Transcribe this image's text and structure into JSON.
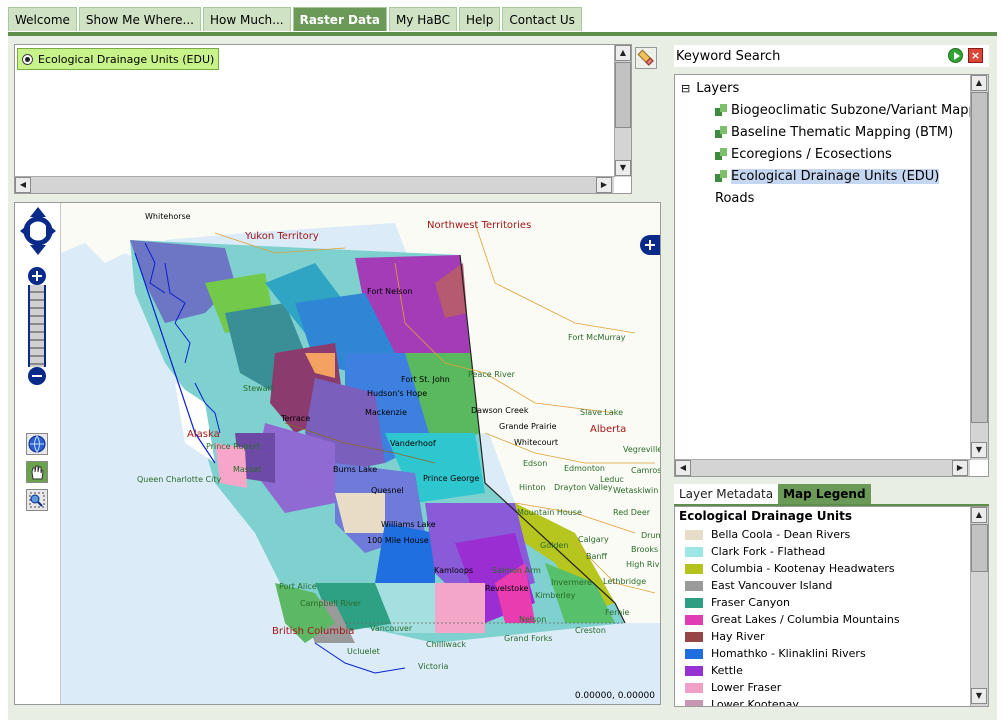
{
  "nav": {
    "tabs": [
      {
        "label": "Welcome",
        "active": false
      },
      {
        "label": "Show Me Where...",
        "active": false
      },
      {
        "label": "How Much...",
        "active": false
      },
      {
        "label": "Raster Data",
        "active": true
      },
      {
        "label": "My HaBC",
        "active": false
      },
      {
        "label": "Help",
        "active": false
      },
      {
        "label": "Contact Us",
        "active": false
      }
    ]
  },
  "selected_layers": {
    "item_label": "Ecological Drainage Units (EDU)",
    "eraser_icon": "eraser-icon"
  },
  "map": {
    "coordinate_readout": "0.00000, 0.00000",
    "labels": {
      "whitehorse": "Whitehorse",
      "yukon": "Yukon Territory",
      "nwt": "Northwest Territories",
      "fort_nelson": "Fort Nelson",
      "fort_mcmurray": "Fort McMurray",
      "peace_river": "Peace River",
      "stewart": "Stewart",
      "alaska": "Alaska",
      "hudsons_hope": "Hudson's Hope",
      "fort_st_john": "Fort St. John",
      "dawson_creek": "Dawson Creek",
      "slave_lake": "Slave Lake",
      "grande_prairie": "Grande Prairie",
      "whitecourt": "Whitecourt",
      "alberta": "Alberta",
      "prince_rupert": "Prince Rupert",
      "terrace": "Terrace",
      "mackenzie": "Mackenzie",
      "vanderhoof": "Vanderhoof",
      "edson": "Edson",
      "edmonton": "Edmonton",
      "vegreville": "Vegreville",
      "camrose": "Camrose",
      "queen_charlotte": "Queen Charlotte City",
      "masset": "Masset",
      "burns_lake": "Burns Lake",
      "prince_george": "Prince George",
      "hinton": "Hinton",
      "drayton_valley": "Drayton Valley",
      "leduc": "Leduc",
      "wetaskiwin": "Wetaskiwin",
      "quesnel": "Quesnel",
      "mountain_house": "Mountain House",
      "red_deer": "Red Deer",
      "williams_lake": "Williams Lake",
      "hundred_mile": "100 Mile House",
      "calgary": "Calgary",
      "drumheller": "Drumheller",
      "brooks": "Brooks",
      "high_river": "High River",
      "golden": "Golden",
      "banff": "Banff",
      "kamloops": "Kamloops",
      "salmon_arm": "Salmon Arm",
      "invermere": "Invermere",
      "lethbridge": "Lethbridge",
      "kimberley": "Kimberley",
      "port_alice": "Port Alice",
      "campbell_river": "Campbell River",
      "british_columbia": "British Columbia",
      "vancouver": "Vancouver",
      "chilliwack": "Chilliwack",
      "ucluelet": "Ucluelet",
      "victoria": "Victoria",
      "grand_forks": "Grand Forks",
      "creston": "Creston",
      "nelson": "Nelson",
      "revelstoke": "Revelstoke",
      "fernie": "Fernie"
    }
  },
  "keyword_search": {
    "title": "Keyword Search",
    "go_icon": "play-icon",
    "close_icon": "close-icon"
  },
  "layer_tree": {
    "root_label": "Layers",
    "expander": "⊟",
    "items": [
      {
        "label": "Biogeoclimatic Subzone/Variant Mapping",
        "selected": false
      },
      {
        "label": "Baseline Thematic Mapping (BTM)",
        "selected": false
      },
      {
        "label": "Ecoregions / Ecosections",
        "selected": false
      },
      {
        "label": "Ecological Drainage Units (EDU)",
        "selected": true
      }
    ],
    "roads_label": "Roads"
  },
  "legend_tabs": {
    "metadata": "Layer Metadata",
    "legend": "Map Legend"
  },
  "legend": {
    "title": "Ecological Drainage Units",
    "items": [
      {
        "label": "Bella Coola - Dean Rivers",
        "color": "#e6dcc8"
      },
      {
        "label": "Clark Fork - Flathead",
        "color": "#9ee6e6"
      },
      {
        "label": "Columbia - Kootenay Headwaters",
        "color": "#b4c21e"
      },
      {
        "label": "East Vancouver Island",
        "color": "#9a9a9a"
      },
      {
        "label": "Fraser Canyon",
        "color": "#2e9e82"
      },
      {
        "label": "Great Lakes / Columbia Mountains",
        "color": "#e03cb4"
      },
      {
        "label": "Hay River",
        "color": "#964646"
      },
      {
        "label": "Homathko - Klinaklini Rivers",
        "color": "#1e6ee0"
      },
      {
        "label": "Kettle",
        "color": "#9632d2"
      },
      {
        "label": "Lower Fraser",
        "color": "#f0a0c8"
      },
      {
        "label": "Lower Kootenay",
        "color": "#c896b4"
      }
    ]
  }
}
